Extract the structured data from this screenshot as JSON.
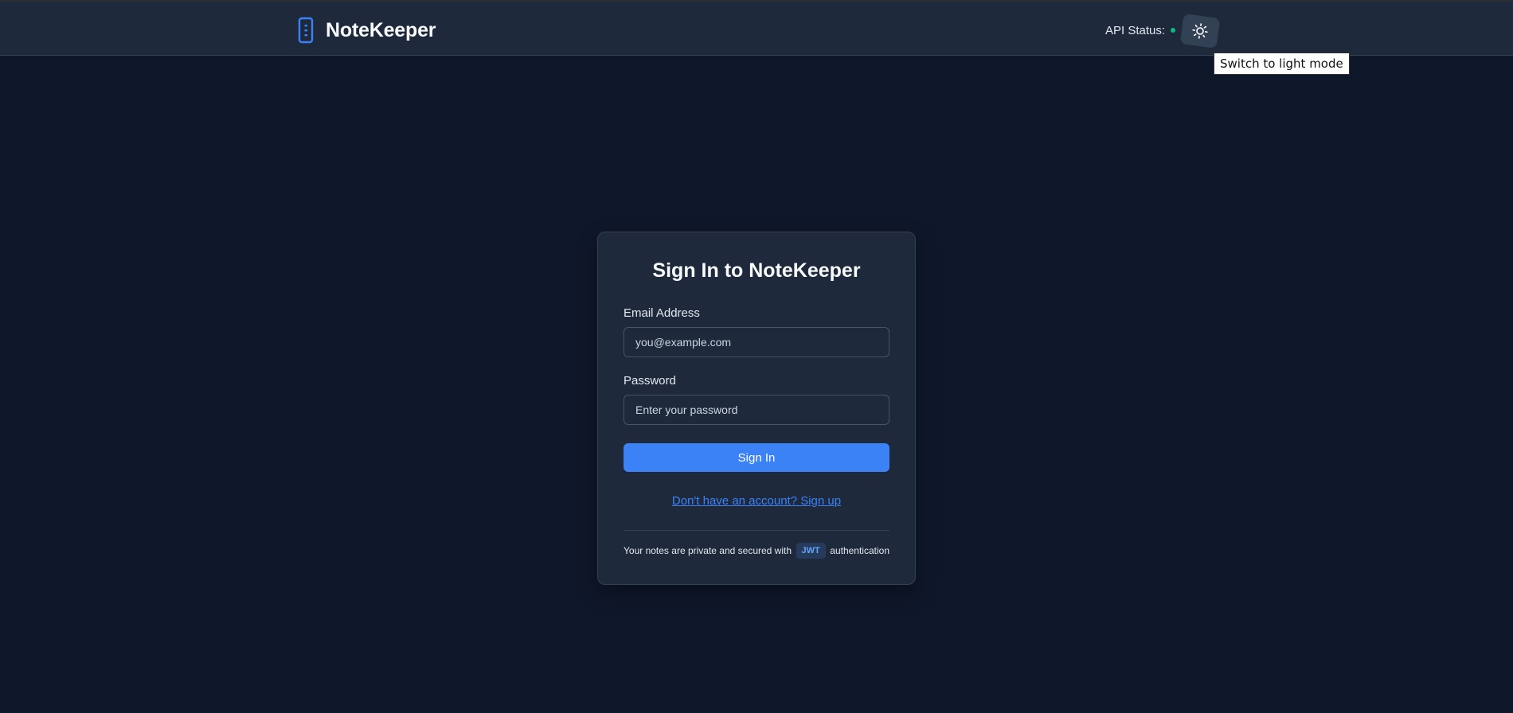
{
  "header": {
    "brand_name": "NoteKeeper",
    "brand_icon": "notebook-icon",
    "api_status_label": "API Status:",
    "api_status_color": "#10b981",
    "theme_toggle_icon": "sun-icon",
    "tooltip": "Switch to light mode"
  },
  "login": {
    "title": "Sign In to NoteKeeper",
    "email_label": "Email Address",
    "email_placeholder": "you@example.com",
    "email_value": "",
    "password_label": "Password",
    "password_placeholder": "Enter your password",
    "password_value": "",
    "submit_label": "Sign In",
    "signup_link": "Don't have an account? Sign up",
    "footer_prefix": "Your notes are private and secured with",
    "footer_badge": "JWT",
    "footer_suffix": "authentication"
  },
  "colors": {
    "background": "#0f172a",
    "surface": "#1e293b",
    "accent": "#3b82f6"
  }
}
